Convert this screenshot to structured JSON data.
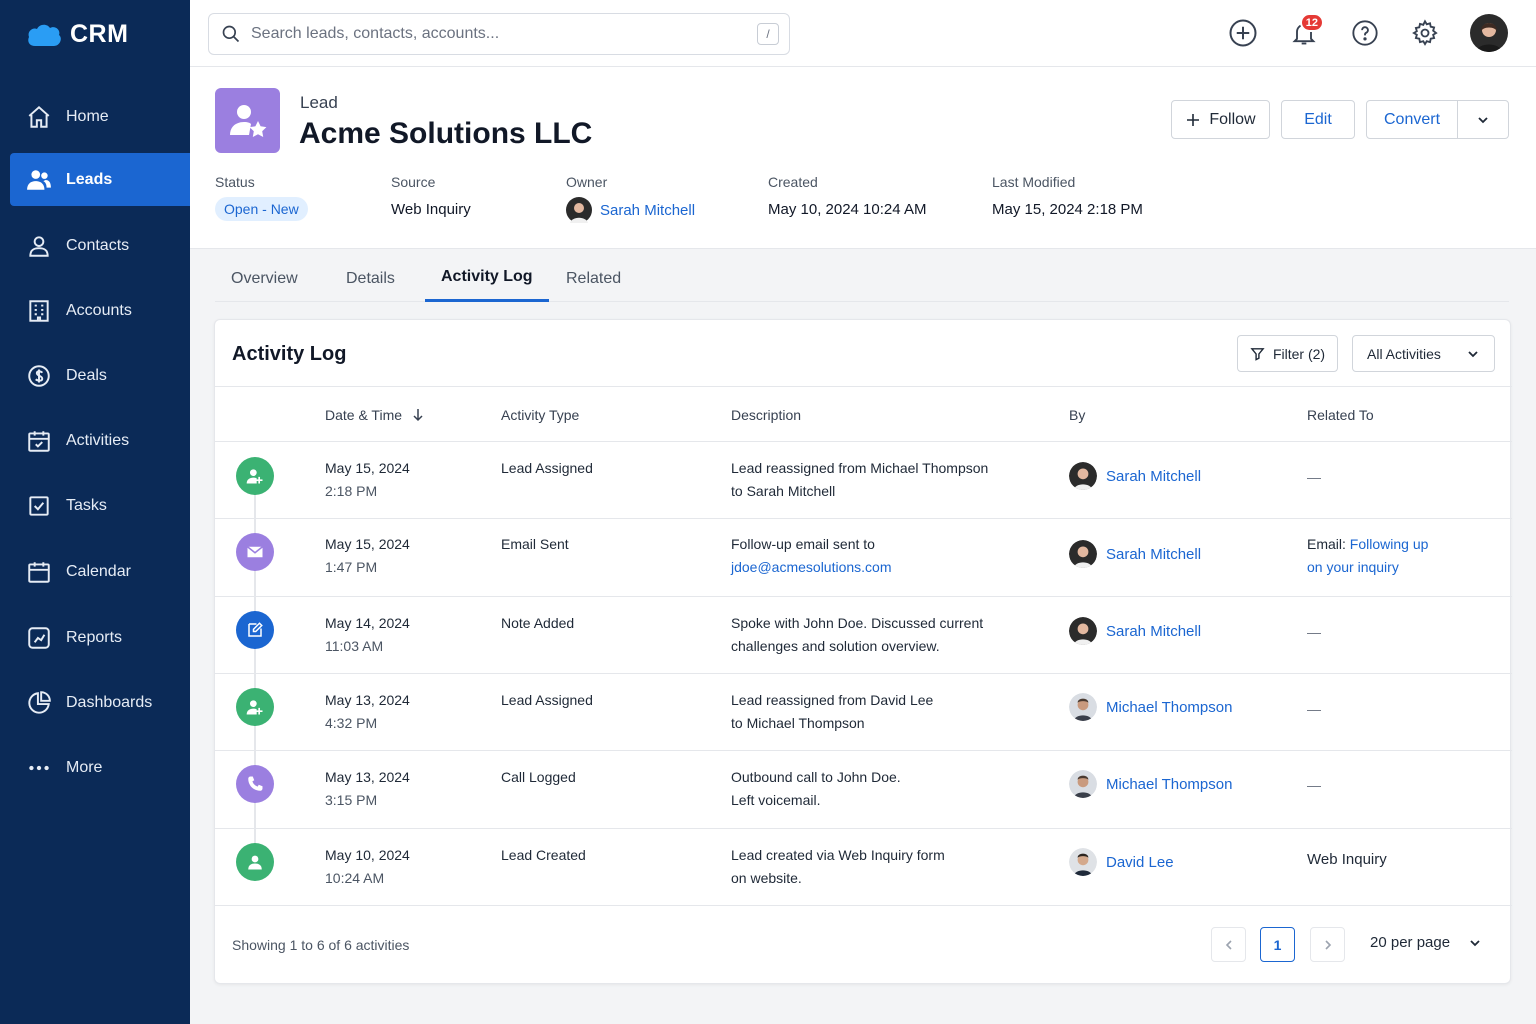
{
  "app": {
    "name": "CRM",
    "brand_color": "#1b66d1",
    "sidebar_color": "#0b2a57"
  },
  "sidebar": {
    "items": [
      {
        "label": "Home",
        "icon": "home-icon"
      },
      {
        "label": "Leads",
        "icon": "leads-icon",
        "active": true
      },
      {
        "label": "Contacts",
        "icon": "contact-icon"
      },
      {
        "label": "Accounts",
        "icon": "building-icon"
      },
      {
        "label": "Deals",
        "icon": "dollar-icon"
      },
      {
        "label": "Activities",
        "icon": "calendar-check-icon"
      },
      {
        "label": "Tasks",
        "icon": "checkbox-icon"
      },
      {
        "label": "Calendar",
        "icon": "calendar-icon"
      },
      {
        "label": "Reports",
        "icon": "report-icon"
      },
      {
        "label": "Dashboards",
        "icon": "pie-chart-icon"
      },
      {
        "label": "More",
        "icon": "more-icon"
      }
    ]
  },
  "topbar": {
    "search_placeholder": "Search leads, contacts, accounts...",
    "search_shortcut": "/",
    "notification_count": "12"
  },
  "lead": {
    "kicker": "Lead",
    "name": "Acme Solutions LLC",
    "actions": {
      "follow": "Follow",
      "edit": "Edit",
      "convert": "Convert"
    },
    "meta": {
      "status_label": "Status",
      "status_value": "Open - New",
      "source_label": "Source",
      "source_value": "Web Inquiry",
      "owner_label": "Owner",
      "owner_value": "Sarah Mitchell",
      "created_label": "Created",
      "created_value": "May 10, 2024 10:24 AM",
      "modified_label": "Last Modified",
      "modified_value": "May 15, 2024 2:18 PM"
    }
  },
  "tabs": [
    "Overview",
    "Details",
    "Activity Log",
    "Related"
  ],
  "activity_log": {
    "title": "Activity Log",
    "filter_label": "Filter (2)",
    "select_label": "All Activities",
    "columns": {
      "datetime": "Date & Time",
      "type": "Activity Type",
      "description": "Description",
      "by": "By",
      "related": "Related To"
    },
    "rows": [
      {
        "date": "May 15, 2024",
        "time": "2:18 PM",
        "type": "Lead Assigned",
        "desc1": "Lead reassigned from Michael Thompson",
        "desc2": "to Sarah Mitchell",
        "by": "Sarah Mitchell",
        "related": "—",
        "icon": "user-plus-icon",
        "color": "#3bb273"
      },
      {
        "date": "May 15, 2024",
        "time": "1:47 PM",
        "type": "Email Sent",
        "desc1": "Follow-up email sent to",
        "desc2": "jdoe@acmesolutions.com",
        "by": "Sarah Mitchell",
        "related_prefix": "Email: ",
        "related_link1": "Following up",
        "related_link2": "on your inquiry",
        "icon": "mail-icon",
        "color": "#9b7fe0"
      },
      {
        "date": "May 14, 2024",
        "time": "11:03 AM",
        "type": "Note Added",
        "desc1": "Spoke with John Doe. Discussed current",
        "desc2": "challenges and solution overview.",
        "by": "Sarah Mitchell",
        "related": "—",
        "icon": "note-icon",
        "color": "#1b66d1"
      },
      {
        "date": "May 13, 2024",
        "time": "4:32 PM",
        "type": "Lead Assigned",
        "desc1": "Lead reassigned from David Lee",
        "desc2": "to Michael Thompson",
        "by": "Michael Thompson",
        "related": "—",
        "icon": "user-plus-icon",
        "color": "#3bb273"
      },
      {
        "date": "May 13, 2024",
        "time": "3:15 PM",
        "type": "Call Logged",
        "desc1": "Outbound call to John Doe.",
        "desc2": "Left voicemail.",
        "by": "Michael Thompson",
        "related": "—",
        "icon": "phone-icon",
        "color": "#9b7fe0"
      },
      {
        "date": "May 10, 2024",
        "time": "10:24 AM",
        "type": "Lead Created",
        "desc1": "Lead created via Web Inquiry form",
        "desc2": "on website.",
        "by": "David Lee",
        "related": "Web Inquiry",
        "icon": "user-icon",
        "color": "#3bb273"
      }
    ],
    "footer": "Showing 1 to 6 of 6 activities",
    "current_page": "1",
    "per_page": "20 per page"
  }
}
